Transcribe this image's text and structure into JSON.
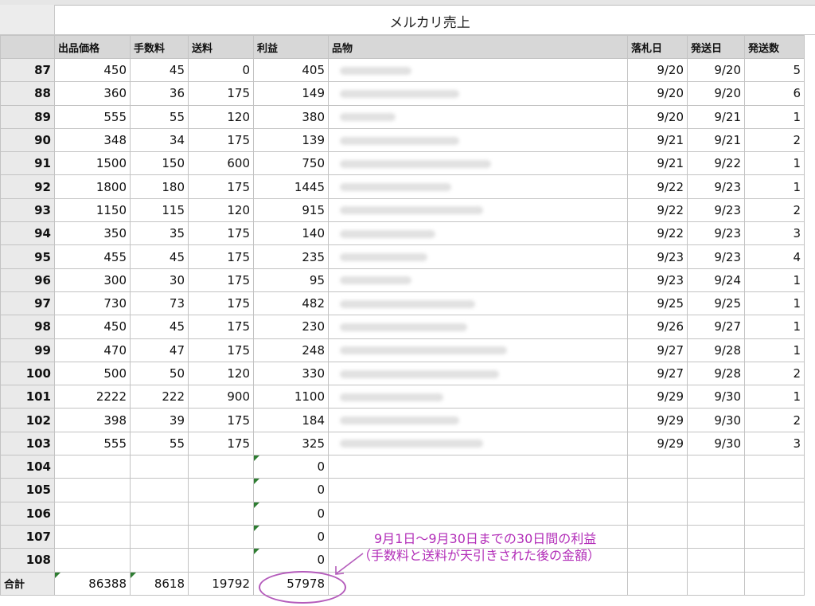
{
  "title": "メルカリ売上",
  "headers": [
    "出品価格",
    "手数料",
    "送料",
    "利益",
    "品物",
    "落札日",
    "発送日",
    "発送数"
  ],
  "rows": [
    {
      "n": "87",
      "price": "450",
      "fee": "45",
      "ship": "0",
      "profit": "405",
      "sold": "9/20",
      "sent": "9/20",
      "qty": "5"
    },
    {
      "n": "88",
      "price": "360",
      "fee": "36",
      "ship": "175",
      "profit": "149",
      "sold": "9/20",
      "sent": "9/20",
      "qty": "6"
    },
    {
      "n": "89",
      "price": "555",
      "fee": "55",
      "ship": "120",
      "profit": "380",
      "sold": "9/20",
      "sent": "9/21",
      "qty": "1"
    },
    {
      "n": "90",
      "price": "348",
      "fee": "34",
      "ship": "175",
      "profit": "139",
      "sold": "9/21",
      "sent": "9/21",
      "qty": "2"
    },
    {
      "n": "91",
      "price": "1500",
      "fee": "150",
      "ship": "600",
      "profit": "750",
      "sold": "9/21",
      "sent": "9/22",
      "qty": "1"
    },
    {
      "n": "92",
      "price": "1800",
      "fee": "180",
      "ship": "175",
      "profit": "1445",
      "sold": "9/22",
      "sent": "9/23",
      "qty": "1"
    },
    {
      "n": "93",
      "price": "1150",
      "fee": "115",
      "ship": "120",
      "profit": "915",
      "sold": "9/22",
      "sent": "9/23",
      "qty": "2"
    },
    {
      "n": "94",
      "price": "350",
      "fee": "35",
      "ship": "175",
      "profit": "140",
      "sold": "9/22",
      "sent": "9/23",
      "qty": "3"
    },
    {
      "n": "95",
      "price": "455",
      "fee": "45",
      "ship": "175",
      "profit": "235",
      "sold": "9/23",
      "sent": "9/23",
      "qty": "4"
    },
    {
      "n": "96",
      "price": "300",
      "fee": "30",
      "ship": "175",
      "profit": "95",
      "sold": "9/23",
      "sent": "9/24",
      "qty": "1"
    },
    {
      "n": "97",
      "price": "730",
      "fee": "73",
      "ship": "175",
      "profit": "482",
      "sold": "9/25",
      "sent": "9/25",
      "qty": "1"
    },
    {
      "n": "98",
      "price": "450",
      "fee": "45",
      "ship": "175",
      "profit": "230",
      "sold": "9/26",
      "sent": "9/27",
      "qty": "1"
    },
    {
      "n": "99",
      "price": "470",
      "fee": "47",
      "ship": "175",
      "profit": "248",
      "sold": "9/27",
      "sent": "9/28",
      "qty": "1"
    },
    {
      "n": "100",
      "price": "500",
      "fee": "50",
      "ship": "120",
      "profit": "330",
      "sold": "9/27",
      "sent": "9/28",
      "qty": "2"
    },
    {
      "n": "101",
      "price": "2222",
      "fee": "222",
      "ship": "900",
      "profit": "1100",
      "sold": "9/29",
      "sent": "9/30",
      "qty": "1"
    },
    {
      "n": "102",
      "price": "398",
      "fee": "39",
      "ship": "175",
      "profit": "184",
      "sold": "9/29",
      "sent": "9/30",
      "qty": "2"
    },
    {
      "n": "103",
      "price": "555",
      "fee": "55",
      "ship": "175",
      "profit": "325",
      "sold": "9/29",
      "sent": "9/30",
      "qty": "3"
    },
    {
      "n": "104",
      "price": "",
      "fee": "",
      "ship": "",
      "profit": "0",
      "sold": "",
      "sent": "",
      "qty": ""
    },
    {
      "n": "105",
      "price": "",
      "fee": "",
      "ship": "",
      "profit": "0",
      "sold": "",
      "sent": "",
      "qty": ""
    },
    {
      "n": "106",
      "price": "",
      "fee": "",
      "ship": "",
      "profit": "0",
      "sold": "",
      "sent": "",
      "qty": ""
    },
    {
      "n": "107",
      "price": "",
      "fee": "",
      "ship": "",
      "profit": "0",
      "sold": "",
      "sent": "",
      "qty": ""
    },
    {
      "n": "108",
      "price": "",
      "fee": "",
      "ship": "",
      "profit": "0",
      "sold": "",
      "sent": "",
      "qty": ""
    }
  ],
  "totals": {
    "label": "合計",
    "price": "86388",
    "fee": "8618",
    "ship": "19792",
    "profit": "57978"
  },
  "annotation": {
    "line1": "9月1日〜9月30日までの30日間の利益",
    "line2": "（手数料と送料が天引きされた後の金額）",
    "color": "#b22db8"
  }
}
